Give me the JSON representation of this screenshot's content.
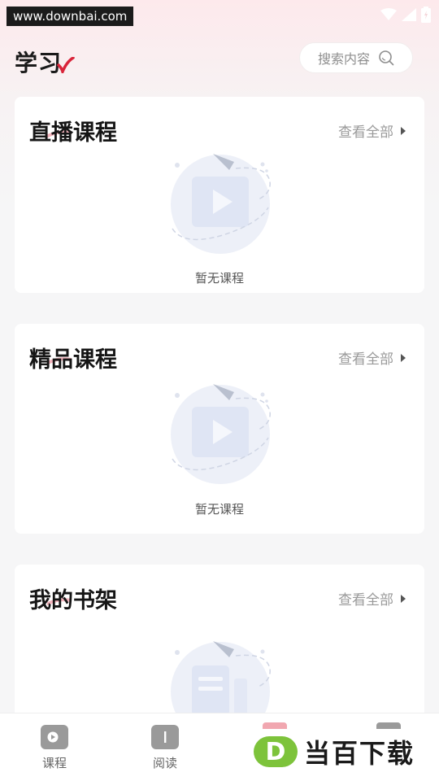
{
  "status_bar": {
    "watermark_url": "www.downbai.com"
  },
  "header": {
    "title": "学习",
    "search_placeholder": "搜索内容"
  },
  "sections": [
    {
      "title": "直播课程",
      "view_all": "查看全部",
      "empty_text": "暂无课程"
    },
    {
      "title": "精品课程",
      "view_all": "查看全部",
      "empty_text": "暂无课程"
    },
    {
      "title": "我的书架",
      "view_all": "查看全部"
    }
  ],
  "bottom_nav": {
    "items": [
      {
        "label": "课程",
        "icon": "video-play-icon"
      },
      {
        "label": "阅读",
        "icon": "book-icon"
      }
    ]
  },
  "overlay_watermark": {
    "logo_letter": "D",
    "text": "当百下载"
  },
  "colors": {
    "accent_red": "#d9243a",
    "watermark_green": "#7dc33b",
    "header_gradient_top": "#fde9ec",
    "illustration_blue": "#e3e8f5"
  }
}
